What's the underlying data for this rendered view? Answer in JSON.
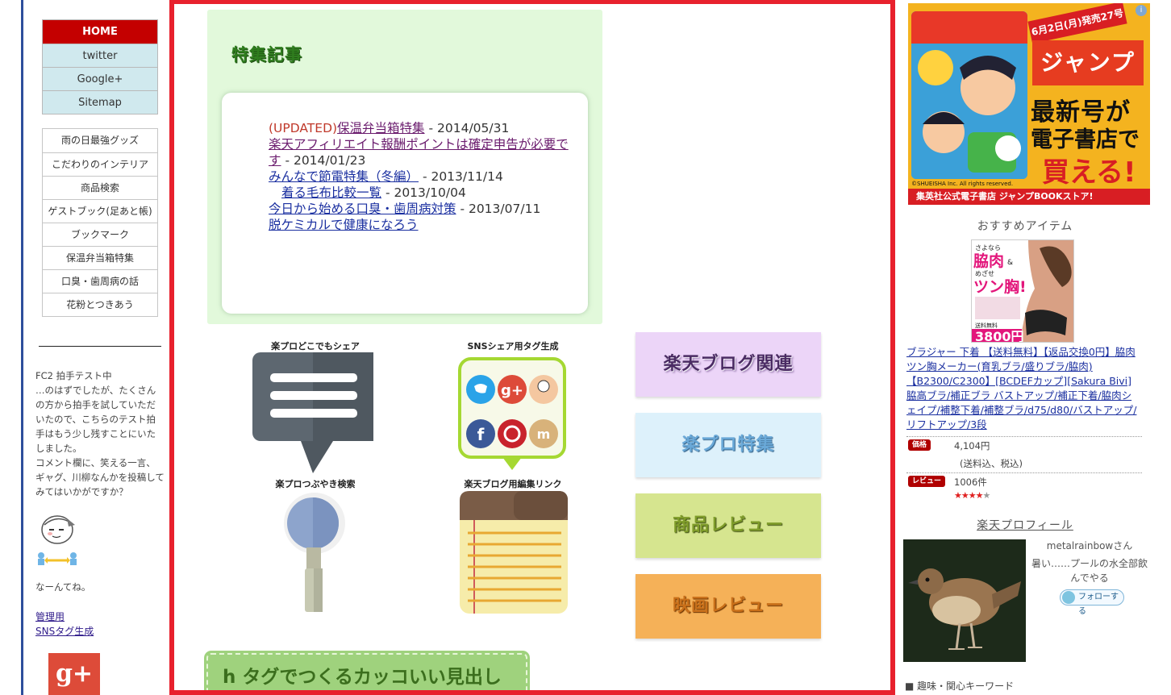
{
  "left_menu": {
    "primary": [
      "HOME",
      "twitter",
      "Google+",
      "Sitemap"
    ],
    "secondary": [
      "雨の日最強グッズ",
      "こだわりのインテリア",
      "商品検索",
      "ゲストブック(足あと帳)",
      "ブックマーク",
      "保温弁当箱特集",
      "口臭・歯周病の話",
      "花粉とつきあう"
    ]
  },
  "left_sidebar": {
    "fc2_text": "FC2 拍手テスト中\n…のはずでしたが、たくさんの方から拍手を試していただいたので、こちらのテスト拍手はもう少し残すことにいたしました。\nコメント欄に、笑える一言、ギャグ、川柳なんかを投稿してみてはいかがですか？",
    "naan": "なーんてね。",
    "admin_link": "管理用",
    "sns_link": "SNSタグ生成",
    "gplus_label": "g+"
  },
  "feature": {
    "title": "特集記事",
    "articles": [
      {
        "prefix": "(UPDATED)",
        "title": "保温弁当箱特集",
        "date": " - 2014/05/31"
      },
      {
        "prefix": "",
        "title": "楽天アフィリエイト報酬ポイントは確定申告が必要です",
        "date": " - 2014/01/23"
      },
      {
        "prefix": "",
        "title": "みんなで節電特集（冬編）",
        "date": " - 2013/11/14"
      },
      {
        "prefix": "",
        "title": "着る毛布比較一覧",
        "date": " - 2013/10/04"
      },
      {
        "prefix": "",
        "title": "今日から始める口臭・歯周病対策",
        "date": " - 2013/07/11"
      },
      {
        "prefix": "",
        "title": "脱ケミカルで健康になろう",
        "date": ""
      }
    ]
  },
  "icons": {
    "share_label": "楽プロどこでもシェア",
    "sns_tag_label": "SNSシェア用タグ生成",
    "tweet_search_label": "楽プロつぶやき検索",
    "edit_link_label": "楽天ブログ用編集リンク"
  },
  "buttons": {
    "blog": "楽天ブログ関連",
    "rakupro": "楽プロ特集",
    "review": "商品レビュー",
    "movie": "映画レビュー"
  },
  "htag": "h タグでつくるカッコいい見出し",
  "ad": {
    "close": "i",
    "date": "6月2日(月)発売27号",
    "brand": "ジャンプ",
    "line1": "最新号が",
    "line2": "電子書店で",
    "line3": "買える!",
    "copyright": "©SHUEISHA Inc. All rights reserved.",
    "bottom": "集英社公式電子書店 ジャンプBOOKストア!"
  },
  "recommend": {
    "title": "おすすめアイテム",
    "image_text": "さよなら 脇肉& めざせ ツン胸! 送料無料 3800円",
    "link": "ブラジャー 下着 【送料無料】【返品交換0円】脇肉ツン胸メーカー(育乳ブラ/盛りブラ/脇肉)【B2300/C2300】[BCDEFカップ][Sakura Bivi]脇高ブラ/補正ブラ バストアップ/補正下着/脇肉シェイプ/補整下着/補整ブラ/d75/d80/バストアップ/リフトアップ/3段",
    "price_pill": "価格",
    "price": "4,104円",
    "price_note": "(送料込、税込)",
    "review_pill": "レビュー",
    "review_count": "1006件",
    "stars_on": "★★★★",
    "stars_off": "★",
    "rating": 4
  },
  "profile": {
    "title": "楽天プロフィール",
    "name": "metalrainbowさん",
    "desc": "暑い……プールの水全部飲んでやる",
    "follow": "フォローする"
  },
  "keywords": "■ 趣味・関心キーワード",
  "colors": {
    "home_bg": "#c40000",
    "main_border": "#e8212d",
    "feature_bg": "#e2f9db"
  }
}
